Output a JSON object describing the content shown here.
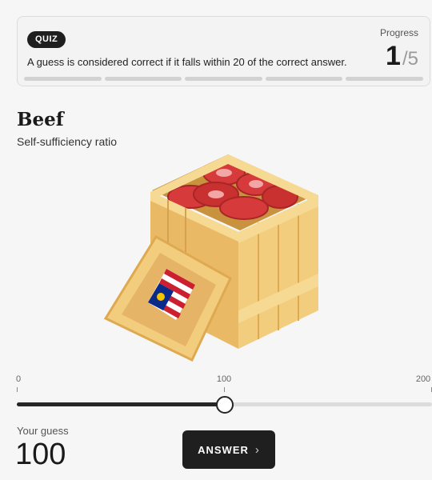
{
  "quiz": {
    "badge": "QUIZ",
    "rule": "A guess is considered correct if it falls within 20 of the correct answer.",
    "progress_label": "Progress",
    "progress_current": "1",
    "progress_separator": "/",
    "progress_total": "5",
    "segments": 5
  },
  "item": {
    "title": "Beef",
    "subtitle": "Self-sufficiency ratio"
  },
  "slider": {
    "min_label": "0",
    "mid_label": "100",
    "max_label": "200",
    "min": 0,
    "max": 200,
    "value": 100
  },
  "guess": {
    "label": "Your guess",
    "value": "100"
  },
  "answer_button": {
    "label": "ANSWER",
    "icon": "chevron-right-icon"
  },
  "colors": {
    "crate": "#f2cd7e",
    "crate_dark": "#dfa951",
    "meat": "#d63a3a",
    "button": "#1f1f1f"
  }
}
